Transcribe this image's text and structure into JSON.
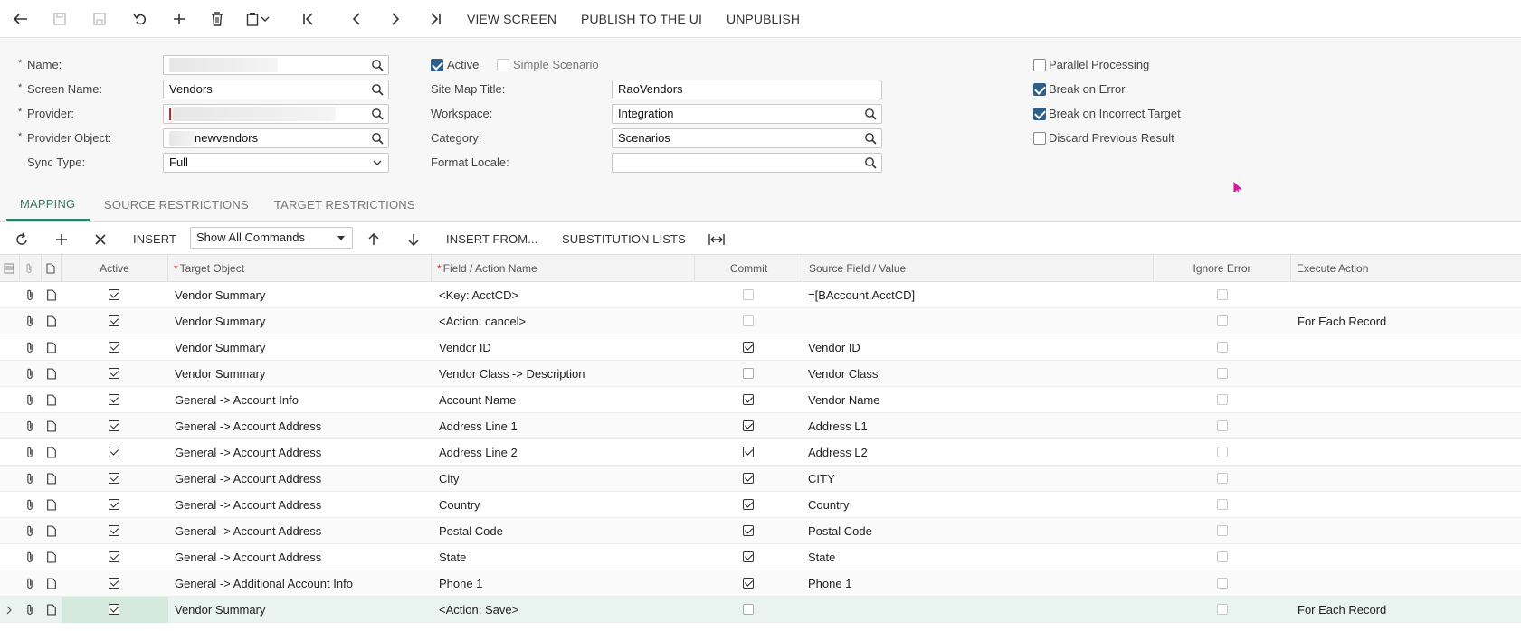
{
  "toolbar": {
    "view_screen": "VIEW SCREEN",
    "publish": "PUBLISH TO THE UI",
    "unpublish": "UNPUBLISH"
  },
  "form": {
    "name_label": "Name:",
    "screen_name_label": "Screen Name:",
    "screen_name_value": "Vendors",
    "provider_label": "Provider:",
    "provider_object_label": "Provider Object:",
    "provider_object_value": "newvendors",
    "sync_type_label": "Sync Type:",
    "sync_type_value": "Full",
    "active_label": "Active",
    "simple_scenario_label": "Simple Scenario",
    "site_map_title_label": "Site Map Title:",
    "site_map_title_value": "RaoVendors",
    "workspace_label": "Workspace:",
    "workspace_value": "Integration",
    "category_label": "Category:",
    "category_value": "Scenarios",
    "format_locale_label": "Format Locale:",
    "format_locale_value": "",
    "parallel_label": "Parallel Processing",
    "break_error_label": "Break on Error",
    "break_incorrect_label": "Break on Incorrect Target",
    "discard_label": "Discard Previous Result",
    "required_mark": "*"
  },
  "tabs": [
    "MAPPING",
    "SOURCE RESTRICTIONS",
    "TARGET RESTRICTIONS"
  ],
  "gridbar": {
    "insert": "INSERT",
    "commands_value": "Show All Commands",
    "insert_from": "INSERT FROM...",
    "substitution": "SUBSTITUTION LISTS"
  },
  "columns": {
    "active": "Active",
    "target_object": "Target Object",
    "field_action": "Field / Action Name",
    "commit": "Commit",
    "source_field": "Source Field / Value",
    "ignore_error": "Ignore Error",
    "execute_action": "Execute Action"
  },
  "rows": [
    {
      "active": true,
      "target": "Vendor Summary",
      "field": "<Key: AcctCD>",
      "commit": false,
      "commit_light": true,
      "source": "=[BAccount.AcctCD]",
      "ignore": false,
      "execute": ""
    },
    {
      "active": true,
      "target": "Vendor Summary",
      "field": "<Action: cancel>",
      "commit": false,
      "commit_light": true,
      "source": "",
      "ignore": false,
      "execute": "For Each Record"
    },
    {
      "active": true,
      "target": "Vendor Summary",
      "field": "Vendor ID",
      "commit": true,
      "commit_light": false,
      "source": "Vendor ID",
      "ignore": false,
      "execute": ""
    },
    {
      "active": true,
      "target": "Vendor Summary",
      "field": "Vendor Class -> Description",
      "commit": false,
      "commit_light": false,
      "source": "Vendor Class",
      "ignore": false,
      "execute": ""
    },
    {
      "active": true,
      "target": "General -> Account Info",
      "field": "Account Name",
      "commit": true,
      "commit_light": false,
      "source": "Vendor Name",
      "ignore": false,
      "execute": ""
    },
    {
      "active": true,
      "target": "General -> Account Address",
      "field": "Address Line 1",
      "commit": true,
      "commit_light": false,
      "source": "Address L1",
      "ignore": false,
      "execute": ""
    },
    {
      "active": true,
      "target": "General -> Account Address",
      "field": "Address Line 2",
      "commit": true,
      "commit_light": false,
      "source": "Address L2",
      "ignore": false,
      "execute": ""
    },
    {
      "active": true,
      "target": "General -> Account Address",
      "field": "City",
      "commit": true,
      "commit_light": false,
      "source": "CITY",
      "ignore": false,
      "execute": ""
    },
    {
      "active": true,
      "target": "General -> Account Address",
      "field": "Country",
      "commit": true,
      "commit_light": false,
      "source": "Country",
      "ignore": false,
      "execute": ""
    },
    {
      "active": true,
      "target": "General -> Account Address",
      "field": "Postal Code",
      "commit": true,
      "commit_light": false,
      "source": "Postal Code",
      "ignore": false,
      "execute": ""
    },
    {
      "active": true,
      "target": "General -> Account Address",
      "field": "State",
      "commit": true,
      "commit_light": false,
      "source": "State",
      "ignore": false,
      "execute": ""
    },
    {
      "active": true,
      "target": "General -> Additional Account Info",
      "field": "Phone 1",
      "commit": true,
      "commit_light": false,
      "source": "Phone 1",
      "ignore": false,
      "execute": ""
    },
    {
      "active": true,
      "target": "Vendor Summary",
      "field": "<Action: Save>",
      "commit": false,
      "commit_light": false,
      "source": "",
      "ignore": false,
      "execute": "For Each Record"
    }
  ]
}
